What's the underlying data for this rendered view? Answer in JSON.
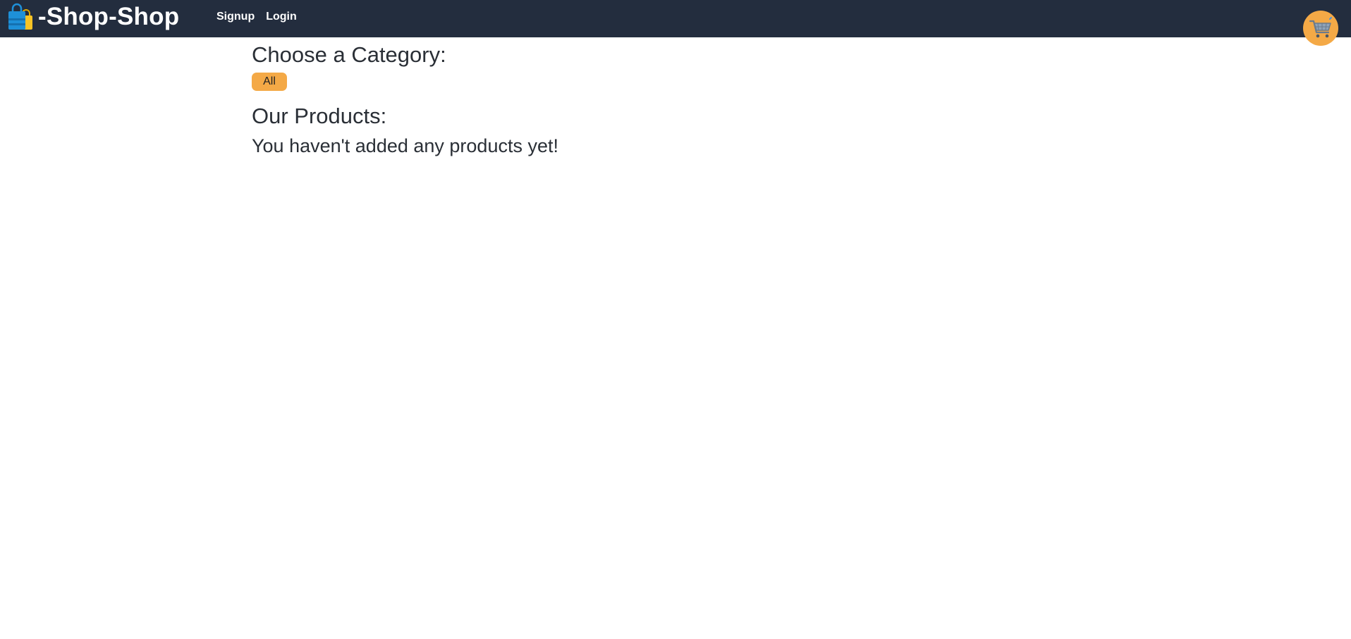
{
  "header": {
    "brand_text": "-Shop-Shop",
    "brand_icon": "shopping-bag-icon",
    "nav": [
      {
        "label": "Signup"
      },
      {
        "label": "Login"
      }
    ],
    "cart_icon": "shopping-cart-icon",
    "background_color": "#232d3e"
  },
  "categories": {
    "heading": "Choose a Category:",
    "items": [
      {
        "label": "All"
      }
    ],
    "button_color": "#f4a946"
  },
  "products": {
    "heading": "Our Products:",
    "empty_message": "You haven't added any products yet!"
  }
}
